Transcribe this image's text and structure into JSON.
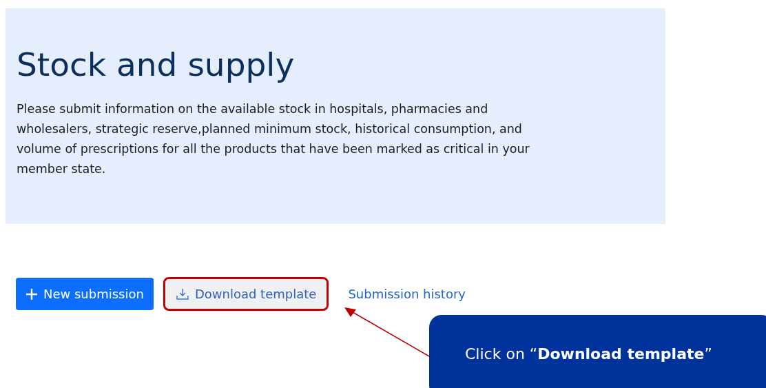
{
  "banner": {
    "title": "Stock and supply",
    "description": "Please submit information on the available stock in hospitals, pharmacies and wholesalers, strategic reserve,planned minimum stock, historical consumption, and volume of prescriptions for all the products that have been marked as critical in your member state."
  },
  "actions": [
    {
      "kind": "primary",
      "label": "New submission",
      "highlighted": false
    },
    {
      "kind": "secondary",
      "label": "Download template",
      "highlighted": true
    },
    {
      "kind": "link",
      "label": "Submission history",
      "highlighted": false
    }
  ],
  "callout": {
    "text": "Click on “**Download template**”"
  }
}
